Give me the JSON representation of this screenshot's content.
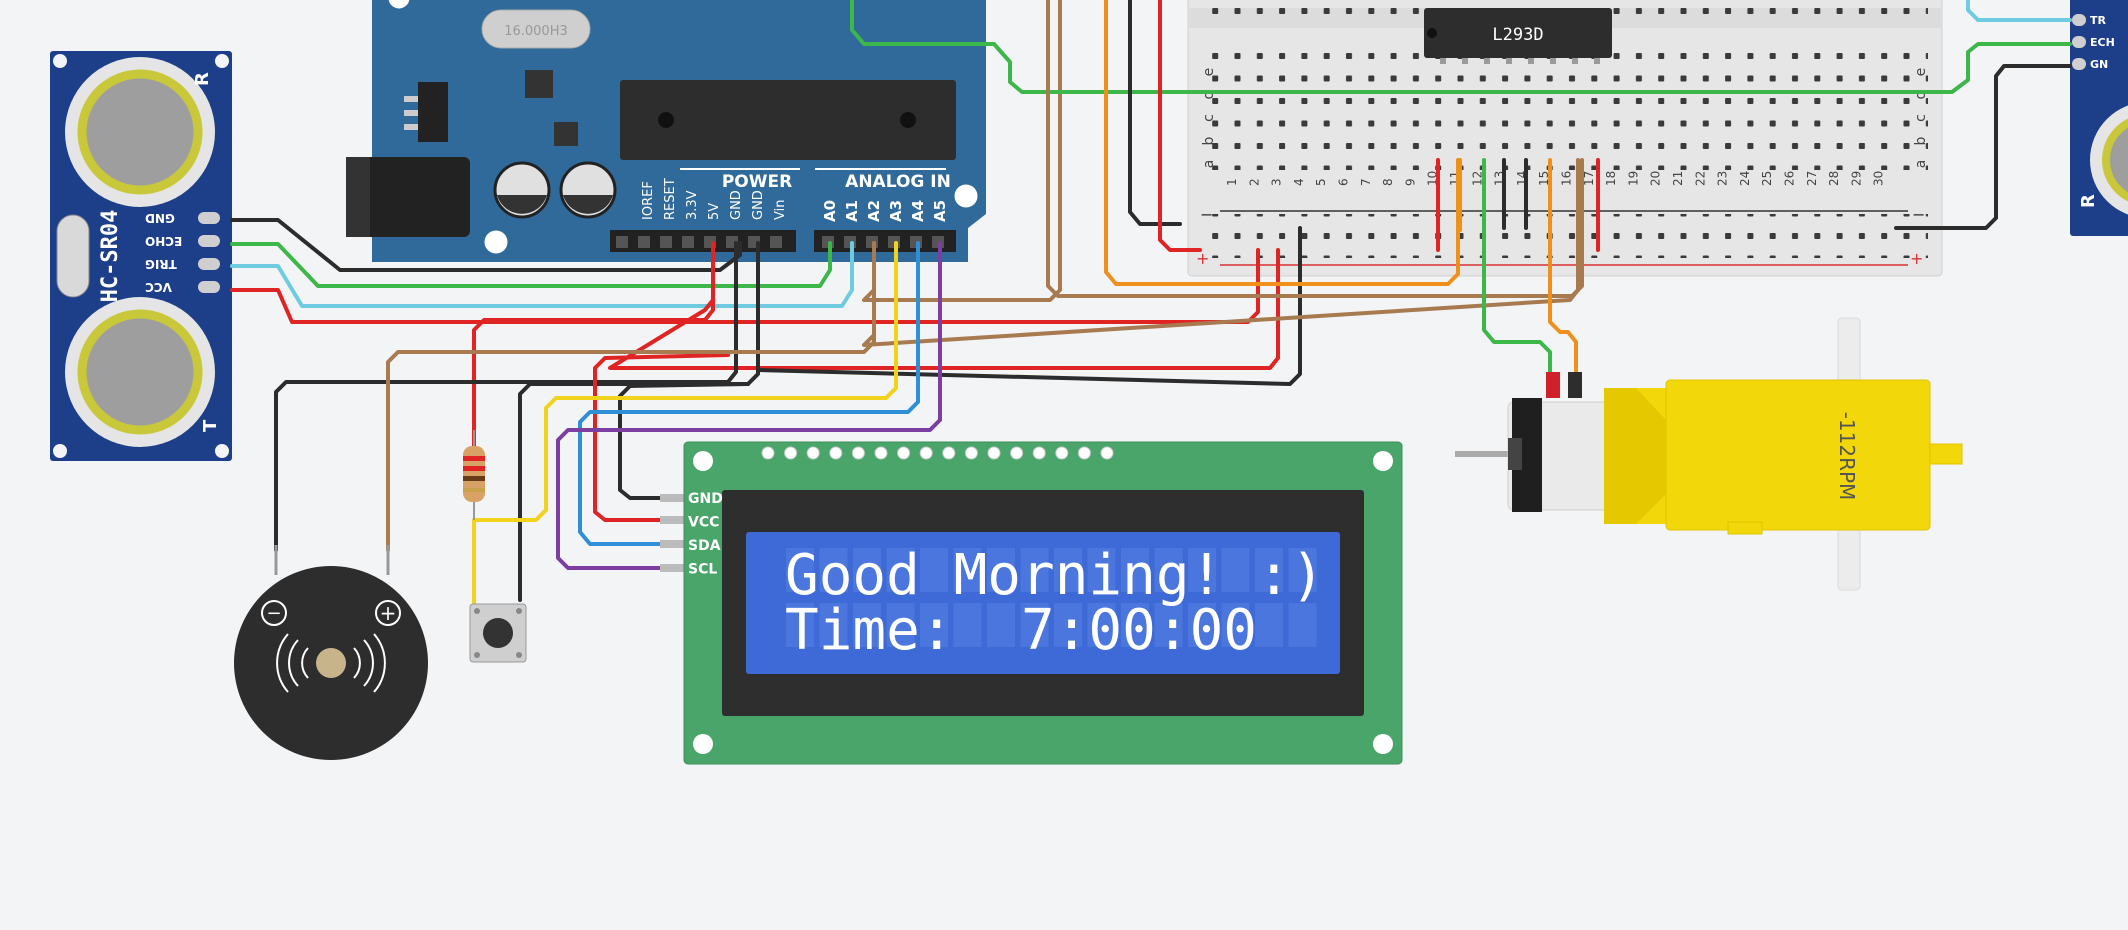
{
  "ultrasonic_left": {
    "model": "HC-SR04",
    "pins": [
      "GND",
      "ECHO",
      "TRIG",
      "VCC"
    ],
    "corner_mark": "R",
    "corner_mark_bottom": "T"
  },
  "ultrasonic_right": {
    "pins": [
      "TR",
      "ECH",
      "GN"
    ],
    "corner_mark": "R"
  },
  "arduino": {
    "crystal_label": "16.000H3",
    "power_title": "POWER",
    "analog_title": "ANALOG IN",
    "power_pins": [
      "IOREF",
      "RESET",
      "3.3V",
      "5V",
      "GND",
      "GND",
      "Vin"
    ],
    "analog_pins": [
      "A0",
      "A1",
      "A2",
      "A3",
      "A4",
      "A5"
    ]
  },
  "motor_driver": {
    "label": "L293D"
  },
  "breadboard": {
    "row_letters_top": [
      "e",
      "d",
      "c",
      "b",
      "a"
    ],
    "column_numbers": [
      "1",
      "2",
      "3",
      "4",
      "5",
      "6",
      "7",
      "8",
      "9",
      "10",
      "11",
      "12",
      "13",
      "14",
      "15",
      "16",
      "17",
      "18",
      "19",
      "20",
      "21",
      "22",
      "23",
      "24",
      "25",
      "26",
      "27",
      "28",
      "29",
      "30"
    ],
    "rail_minus": "−",
    "rail_plus": "+"
  },
  "lcd": {
    "pins": [
      "GND",
      "VCC",
      "SDA",
      "SCL"
    ],
    "line1": "Good Morning! :)",
    "line2": "Time:  7:00:00"
  },
  "motor": {
    "label": "-112RPM"
  },
  "buzzer": {
    "minus": "−",
    "plus": "+"
  },
  "colors": {
    "background": "#f3f4f6",
    "arduino_blue": "#2f6a9a",
    "sensor_blue": "#1d3f8a",
    "lcd_green": "#4aa56a",
    "lcd_screen": "#3d6ad6",
    "motor_yellow": "#f2d70b",
    "wire_red": "#e02424",
    "wire_black": "#2c2c2c",
    "wire_green": "#3db64a",
    "wire_cyan": "#6ecbe0",
    "wire_yellow": "#f1d21c",
    "wire_blue": "#2f8fd6",
    "wire_purple": "#7a3fa0",
    "wire_brown": "#a87a50",
    "wire_orange": "#f0901c"
  }
}
